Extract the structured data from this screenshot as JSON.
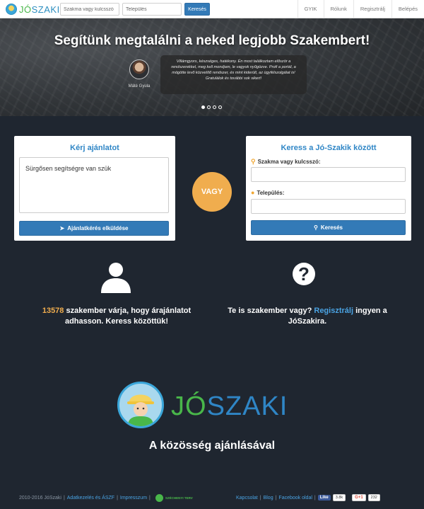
{
  "navbar": {
    "logo_prefix": "JÓ",
    "logo_suffix": "SZAKI",
    "search_placeholder": "Szakma vagy kulcsszó",
    "location_placeholder": "Település",
    "search_button": "Keresés",
    "links": [
      "GYIK",
      "Rólunk",
      "Regisztrálj",
      "Belépés"
    ]
  },
  "hero": {
    "title": "Segítünk megtalálni a neked legjobb Szakembert!",
    "testimonial_name": "Máté Gyula",
    "testimonial_text": "Villámgyors, készséges, hatékony. Én most találkoztam először a rendszerekkel, meg kell mondjam, le vagyok nyűgözve. Profi a portál, a mögötte levő közvetítő rendszer, és mint kiderült, az ügyfélszolgálat is! Gratulálok és további sok sikert!",
    "slides": 4,
    "active_slide": 1
  },
  "request_card": {
    "title": "Kérj ajánlatot",
    "textarea_value": "Sürgősen segítségre van szük",
    "button": "Ajánlatkérés elküldése"
  },
  "or_label": "VAGY",
  "search_card": {
    "title": "Keress a Jó-Szakik között",
    "keyword_label": "Szakma vagy kulcsszó:",
    "location_label": "Település:",
    "button": "Keresés"
  },
  "info": {
    "expert_count": "13578",
    "left_text": "szakember várja, hogy árajánlatot adhasson. Keress közöttük!",
    "right_prefix": "Te is szakember vagy?",
    "right_link": "Regisztrálj",
    "right_suffix": "ingyen a JóSzakira."
  },
  "brand": {
    "logo_prefix": "JÓ",
    "logo_suffix": "SZAKI",
    "tagline": "A közösség ajánlásával"
  },
  "footer": {
    "copyright": "2010-2016 JóSzaki",
    "terms": "Adatkezelés és ÁSZF",
    "imprint": "Impresszum",
    "szechenyi": "SZÉCHENYI TERV",
    "contact": "Kapcsolat",
    "blog": "Blog",
    "facebook": "Facebook oldal",
    "like_label": "Like",
    "like_count": "3.8k",
    "gplus_label": "G+1",
    "gplus_count": "232"
  },
  "colors": {
    "primary": "#337ab7",
    "accent_orange": "#f0ad4e",
    "brand_green": "#49b74a",
    "background": "#1f2630"
  }
}
